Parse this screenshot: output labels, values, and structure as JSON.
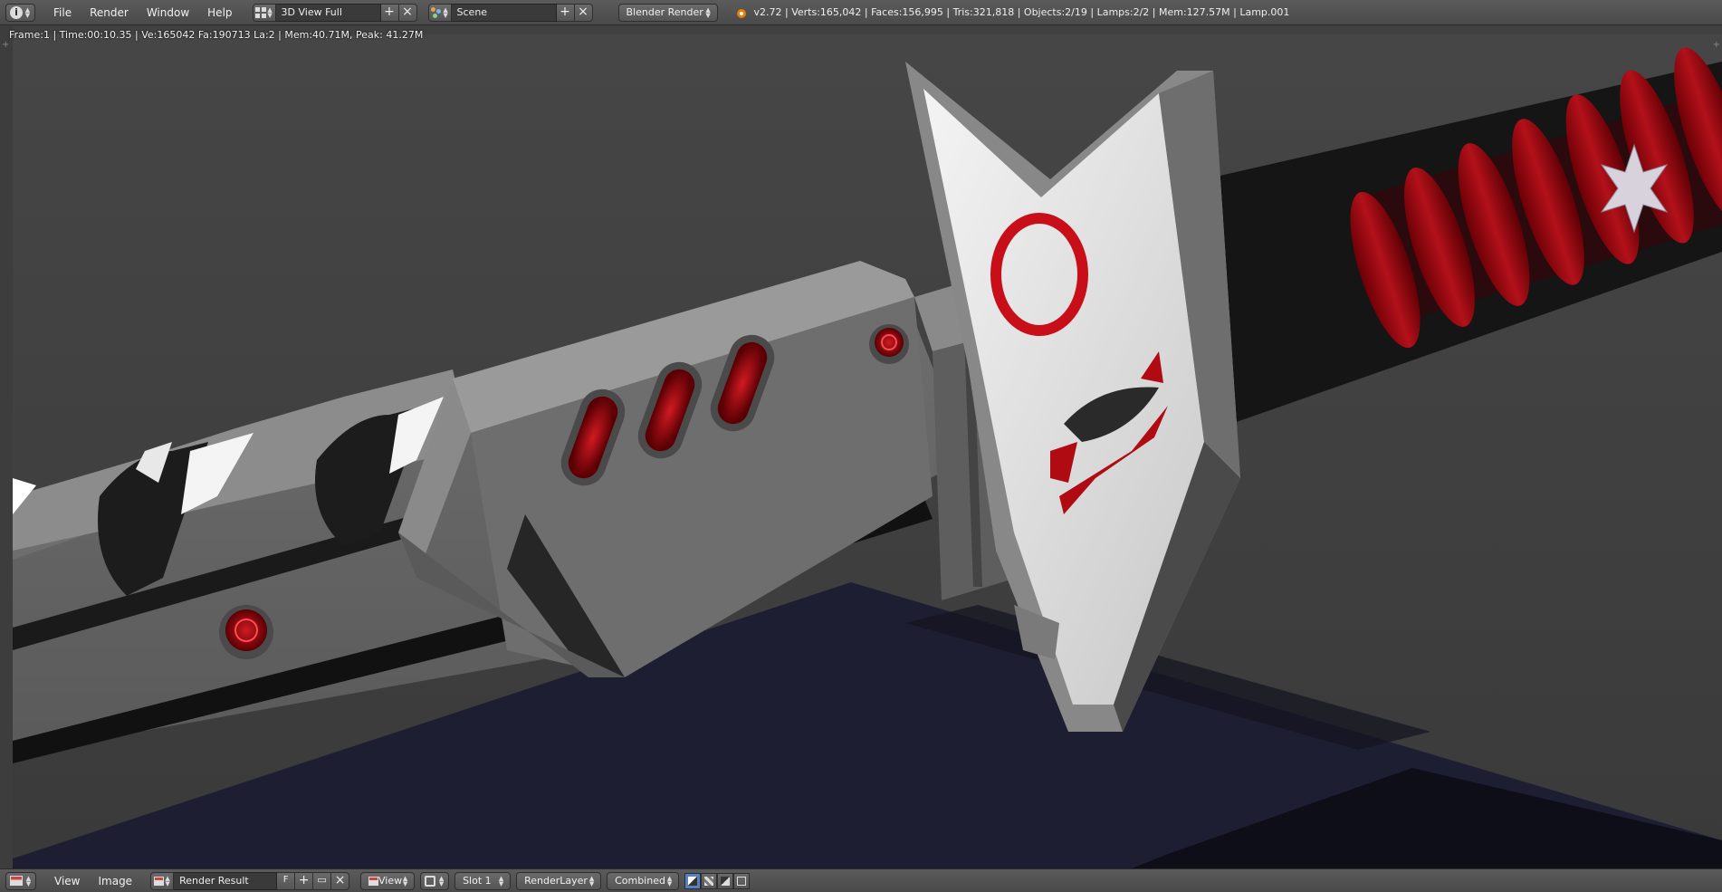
{
  "top": {
    "menus": [
      "File",
      "Render",
      "Window",
      "Help"
    ],
    "layout": "3D View Full",
    "scene": "Scene",
    "engine": "Blender Render",
    "stats": "v2.72 | Verts:165,042 | Faces:156,995 | Tris:321,818 | Objects:2/19 | Lamps:2/2 | Mem:127.57M | Lamp.001"
  },
  "viewport": {
    "render_info": "Frame:1 | Time:00:10.35 | Ve:165042 Fa:190713 La:2 | Mem:40.71M, Peak: 41.27M"
  },
  "bottom": {
    "menus": [
      "View",
      "Image"
    ],
    "image_name": "Render Result",
    "fake_user": "F",
    "view": "View",
    "slot": "Slot 1",
    "layer": "RenderLayer",
    "pass": "Combined"
  },
  "colors": {
    "header_bg": "#4f4f4f",
    "viewport_bg": "#404040",
    "accent_red": "#b00a12",
    "floor": "#1c1c30",
    "logo_orange": "#e87d0d"
  }
}
